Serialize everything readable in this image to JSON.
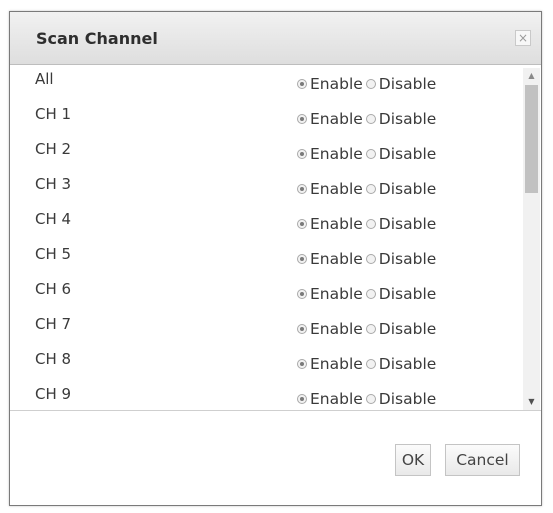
{
  "dialog": {
    "title": "Scan Channel",
    "close_glyph": "×"
  },
  "option_labels": {
    "enable": "Enable",
    "disable": "Disable"
  },
  "channels": [
    {
      "label": "All",
      "selected": "enable"
    },
    {
      "label": "CH 1",
      "selected": "enable"
    },
    {
      "label": "CH 2",
      "selected": "enable"
    },
    {
      "label": "CH 3",
      "selected": "enable"
    },
    {
      "label": "CH 4",
      "selected": "enable"
    },
    {
      "label": "CH 5",
      "selected": "enable"
    },
    {
      "label": "CH 6",
      "selected": "enable"
    },
    {
      "label": "CH 7",
      "selected": "enable"
    },
    {
      "label": "CH 8",
      "selected": "enable"
    },
    {
      "label": "CH 9",
      "selected": "enable"
    }
  ],
  "scrollbar": {
    "up_glyph": "▲",
    "down_glyph": "▼"
  },
  "buttons": {
    "ok": "OK",
    "cancel": "Cancel"
  }
}
